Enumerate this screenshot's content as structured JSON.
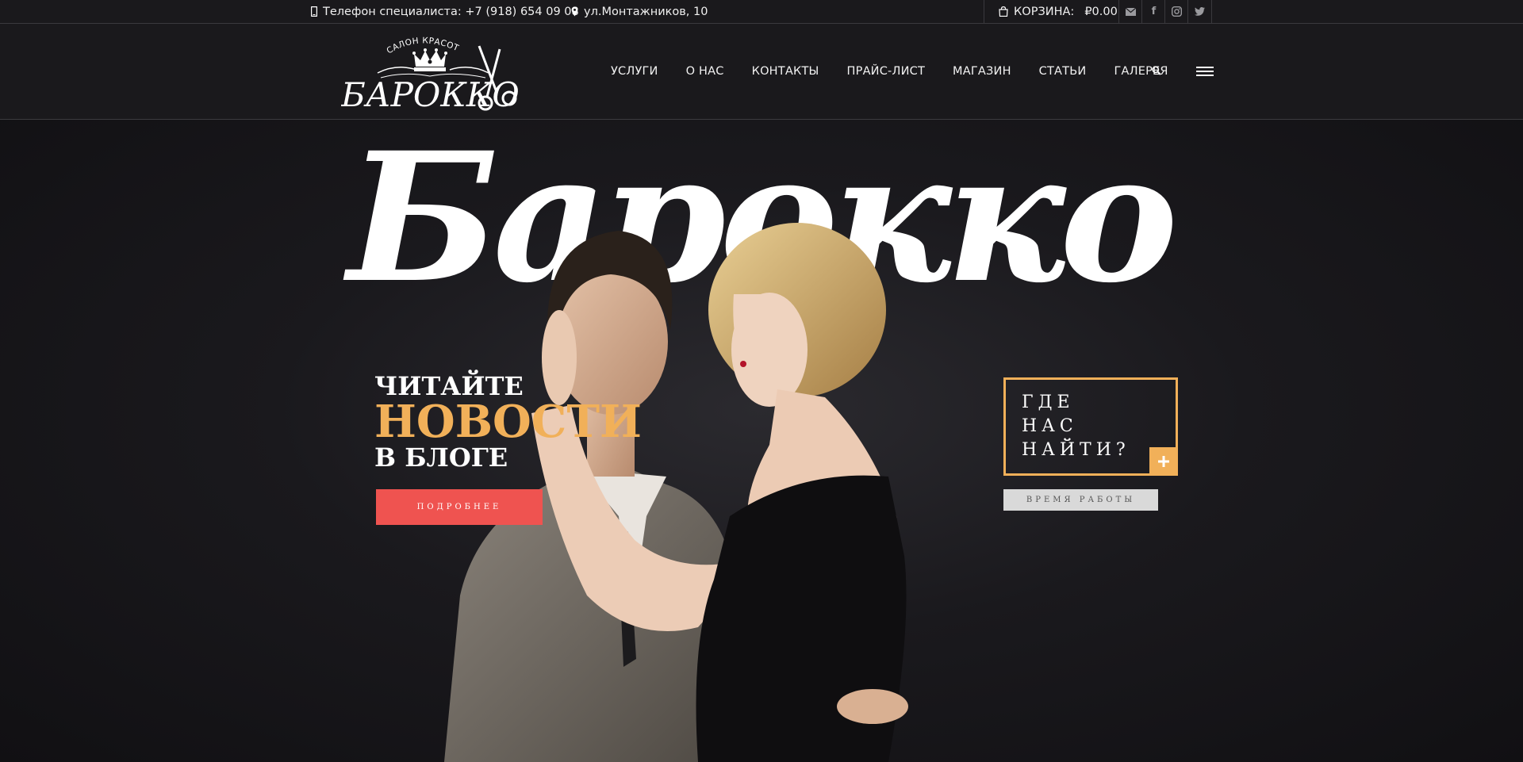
{
  "topbar": {
    "phone_icon": "mobile-phone-icon",
    "phone_text": "Телефон специалиста: +7 (918) 654 09 08",
    "address_icon": "map-pin-icon",
    "address_text": "ул.Монтажников, 10",
    "cart_icon": "shopping-bag-icon",
    "cart_label": "КОРЗИНА:",
    "cart_amount": "₽0.00",
    "social": [
      "email-icon",
      "facebook-icon",
      "instagram-icon",
      "twitter-icon"
    ]
  },
  "header": {
    "logo": {
      "top_text": "САЛОН КРАСОТЫ",
      "name": "БАРОККО",
      "icons": [
        "crown-icon",
        "scissors-icon"
      ]
    },
    "nav": [
      {
        "label": "УСЛУГИ"
      },
      {
        "label": "О НАС"
      },
      {
        "label": "КОНТАКТЫ"
      },
      {
        "label": "ПРАЙС-ЛИСТ"
      },
      {
        "label": "МАГАЗИН"
      },
      {
        "label": "СТАТЬИ"
      },
      {
        "label": "ГАЛЕРЕЯ"
      }
    ],
    "search_icon": "search-icon",
    "menu_icon": "hamburger-menu-icon"
  },
  "hero": {
    "big_word": "Барокко",
    "promo": {
      "line1": "ЧИТАЙТЕ",
      "line2": "НОВОСТИ",
      "line3": "В БЛОГЕ",
      "button": "ПОДРОБНЕЕ"
    },
    "find_box": {
      "lines": [
        "ГДЕ",
        "НАС",
        "НАЙТИ?"
      ],
      "plus_icon": "plus-icon"
    },
    "hours_button": "ВРЕМЯ РАБОТЫ"
  },
  "colors": {
    "background": "#151417",
    "accent_gold": "#f1b059",
    "accent_red": "#ef5350"
  }
}
